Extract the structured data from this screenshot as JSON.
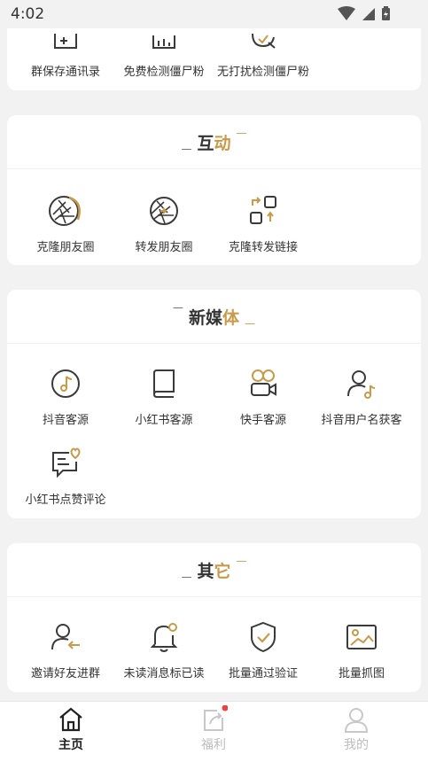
{
  "status_bar": {
    "time": "4:02"
  },
  "section_top": {
    "items": [
      {
        "label": "群保存通讯录"
      },
      {
        "label": "免费检测僵尸粉"
      },
      {
        "label": "无打扰检测僵尸粉"
      }
    ]
  },
  "section_interact": {
    "title_part1": "互",
    "title_part2": "动",
    "items": [
      {
        "label": "克隆朋友圈"
      },
      {
        "label": "转发朋友圈"
      },
      {
        "label": "克隆转发链接"
      }
    ]
  },
  "section_media": {
    "title_part1": "新媒",
    "title_part2": "体",
    "items": [
      {
        "label": "抖音客源"
      },
      {
        "label": "小红书客源"
      },
      {
        "label": "快手客源"
      },
      {
        "label": "抖音用户名获客"
      },
      {
        "label": "小红书点赞评论"
      }
    ]
  },
  "section_other": {
    "title_part1": "其",
    "title_part2": "它",
    "items": [
      {
        "label": "邀请好友进群"
      },
      {
        "label": "未读消息标已读"
      },
      {
        "label": "批量通过验证"
      },
      {
        "label": "批量抓图"
      }
    ]
  },
  "bottom_nav": {
    "items": [
      {
        "label": "主页"
      },
      {
        "label": "福利"
      },
      {
        "label": "我的"
      }
    ]
  },
  "colors": {
    "accent": "#c89a4a",
    "badge": "#f04040",
    "icon_dark": "#3a3a3a"
  }
}
